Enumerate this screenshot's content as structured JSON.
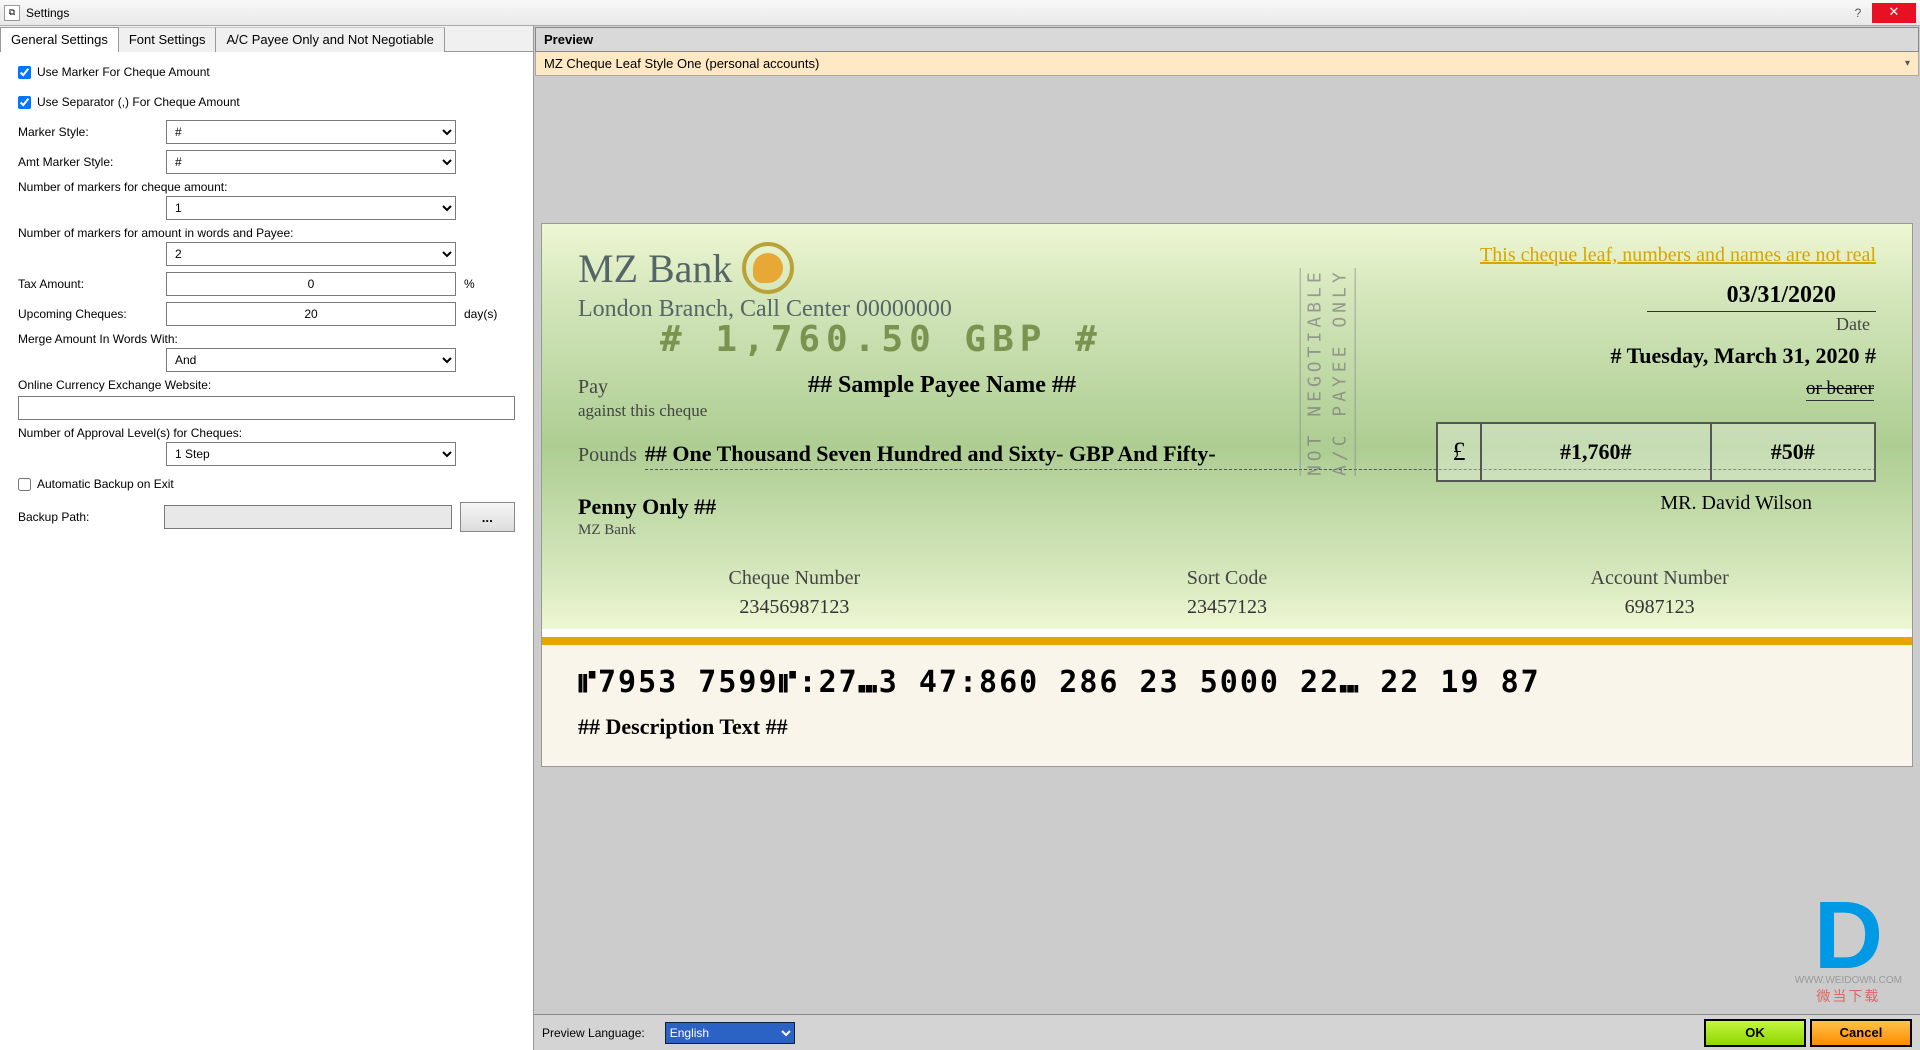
{
  "window": {
    "title": "Settings"
  },
  "tabs": {
    "general": "General Settings",
    "font": "Font Settings",
    "ac": "A/C Payee Only and Not Negotiable"
  },
  "settings": {
    "use_marker_label": "Use Marker For Cheque Amount",
    "use_separator_label": "Use Separator (,) For Cheque Amount",
    "marker_style_label": "Marker Style:",
    "marker_style_value": "#",
    "amt_marker_style_label": "Amt Marker Style:",
    "amt_marker_style_value": "#",
    "num_markers_amount_label": "Number of markers for cheque amount:",
    "num_markers_amount_value": "1",
    "num_markers_words_label": "Number of markers for amount in words and Payee:",
    "num_markers_words_value": "2",
    "tax_label": "Tax Amount:",
    "tax_value": "0",
    "tax_suffix": "%",
    "upcoming_label": "Upcoming Cheques:",
    "upcoming_value": "20",
    "upcoming_suffix": "day(s)",
    "merge_label": "Merge Amount In Words With:",
    "merge_value": "And",
    "exchange_label": "Online Currency Exchange Website:",
    "exchange_value": "",
    "approval_label": "Number of Approval Level(s) for Cheques:",
    "approval_value": "1 Step",
    "auto_backup_label": "Automatic Backup on Exit",
    "backup_path_label": "Backup Path:",
    "backup_path_value": "",
    "browse_label": "..."
  },
  "preview": {
    "header": "Preview",
    "style_name": "MZ Cheque Leaf Style One (personal accounts)",
    "lang_label": "Preview Language:",
    "lang_value": "English"
  },
  "cheque": {
    "bank_name": "MZ Bank",
    "notice": "This cheque leaf, numbers and names are not real",
    "branch": "London Branch, Call Center 00000000",
    "dot_amount": "# 1,760.50 GBP #",
    "date_short": "03/31/2020",
    "date_lbl": "Date",
    "date_long": "# Tuesday, March 31, 2020 #",
    "pay_lbl": "Pay",
    "payee": "## Sample Payee Name ##",
    "against": "against this cheque",
    "or_bearer": "or bearer",
    "pounds_lbl": "Pounds",
    "words_line1": "## One Thousand Seven Hundred and Sixty- GBP And Fifty-",
    "words_line2": "Penny Only ##",
    "small_bank": "MZ Bank",
    "currency_symbol": "£",
    "amount_major": "#1,760#",
    "amount_minor": "#50#",
    "signatory": "MR. David Wilson",
    "stamp1": "NOT NEGOTIABLE",
    "stamp2": "A/C PAYEE ONLY",
    "col1_hdr": "Cheque Number",
    "col1_val": "23456987123",
    "col2_hdr": "Sort Code",
    "col2_val": "23457123",
    "col3_hdr": "Account Number",
    "col3_val": "6987123",
    "micr": "⑈7953 7599⑈:27⑉3 47:860 286 23 5000 22⑉ 22 19 87",
    "description": "## Description Text ##"
  },
  "buttons": {
    "ok": "OK",
    "cancel": "Cancel"
  },
  "watermark": {
    "logo": "D",
    "text": "微当下载",
    "url": "WWW.WEIDOWN.COM"
  }
}
